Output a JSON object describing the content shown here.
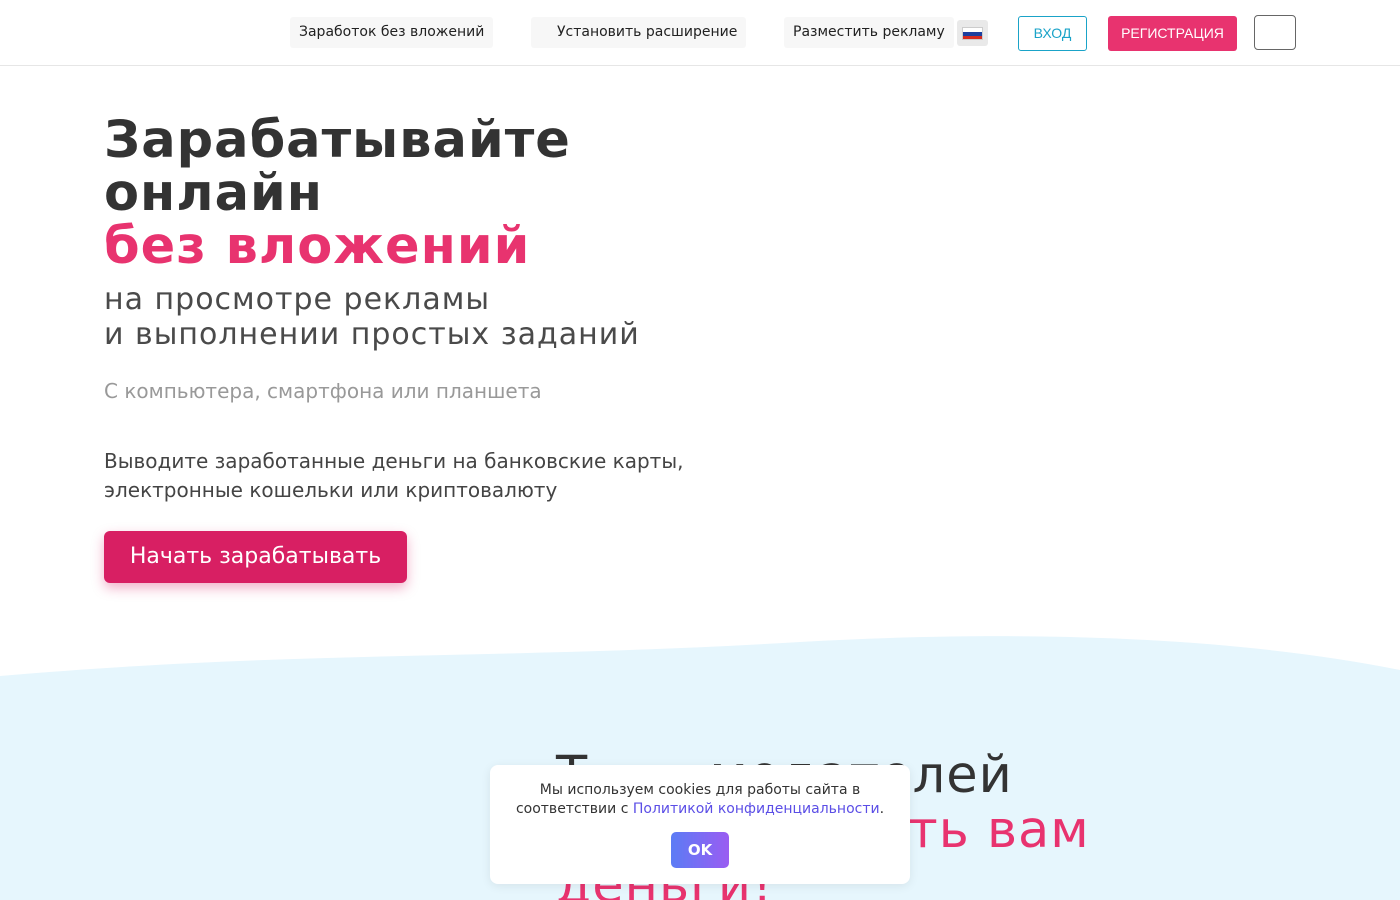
{
  "header": {
    "nav": [
      {
        "label": "Заработок без вложений"
      },
      {
        "label": "Установить расширение"
      },
      {
        "label": "Разместить рекламу"
      }
    ],
    "language": "ru",
    "login_label": "ВХОД",
    "register_label": "РЕГИСТРАЦИЯ"
  },
  "hero": {
    "title_line1": "Зарабатывайте",
    "title_line2": "онлайн",
    "title_accent": "без вложений",
    "subtitle_line1": "на просмотре рекламы",
    "subtitle_line2": "и выполнении простых заданий",
    "devices": "С компьютера, смартфона или планшета",
    "withdraw_line1": "Выводите заработанные деньги на банковские карты,",
    "withdraw_line2": "электронные кошельки или криптовалюту",
    "cta_label": "Начать зарабатывать"
  },
  "section2": {
    "title_line1": "Т…    …модателей",
    "title_accent": "…ть вам",
    "title_line3": "деньги!"
  },
  "cookie": {
    "text_before": "Мы используем cookies для работы сайта в соответствии с ",
    "link": "Политикой конфиденциальности",
    "text_after": ".",
    "ok_label": "OK"
  },
  "colors": {
    "accent": "#e8336f",
    "cta": "#d81f63",
    "login": "#1aa3c8",
    "wave": "#e6f6fd"
  }
}
